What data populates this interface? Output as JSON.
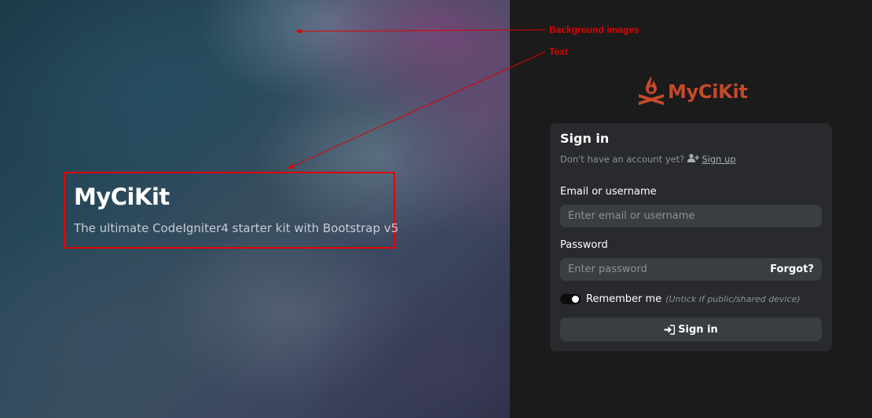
{
  "annotations": {
    "background_images": "Background images",
    "text": "Text"
  },
  "hero": {
    "title": "MyCiKit",
    "subtitle": "The ultimate CodeIgniter4 starter kit with Bootstrap v5"
  },
  "brand": {
    "logo_text": "MyCiKit",
    "color": "#c44a2a",
    "icon": "campfire-icon"
  },
  "signin": {
    "title": "Sign in",
    "no_account": "Don't have an account yet?",
    "signup_icon": "user-plus-icon",
    "signup_label": "Sign up",
    "email_label": "Email or username",
    "email_placeholder": "Enter email or username",
    "password_label": "Password",
    "password_placeholder": "Enter password",
    "forgot_label": "Forgot?",
    "remember_label": "Remember me",
    "remember_note": "(Untick if public/shared device)",
    "remember_checked": true,
    "submit_icon": "sign-in-icon",
    "submit_label": "Sign in"
  },
  "colors": {
    "annotation": "#e00000",
    "card": "#282a2e",
    "panel": "#1c1b1b",
    "input": "#3a3d42"
  }
}
